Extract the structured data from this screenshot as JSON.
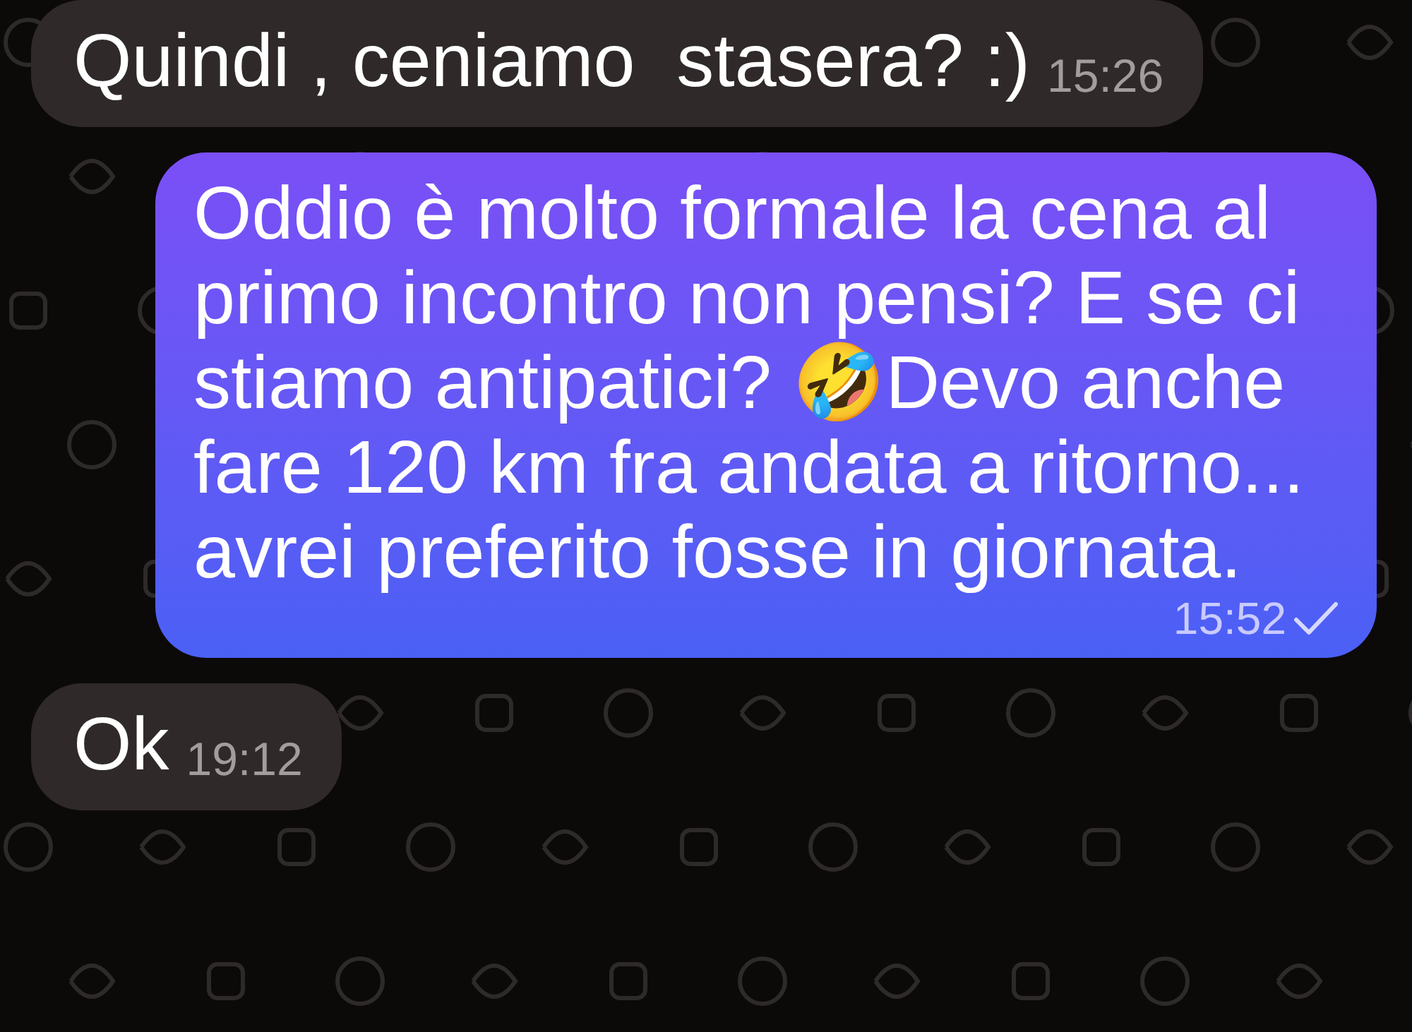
{
  "messages": [
    {
      "kind": "incoming",
      "text": "Quindi , ceniamo  stasera? :)",
      "time": "15:26"
    },
    {
      "kind": "outgoing",
      "text": "Oddio è molto formale la cena al primo incontro non pensi? E se ci stiamo antipatici? 🤣Devo anche fare 120 km fra andata a ritorno... avrei preferito fosse in giornata.",
      "time": "15:52",
      "delivered": true
    },
    {
      "kind": "incoming",
      "text": "Ok",
      "time": "19:12"
    }
  ]
}
